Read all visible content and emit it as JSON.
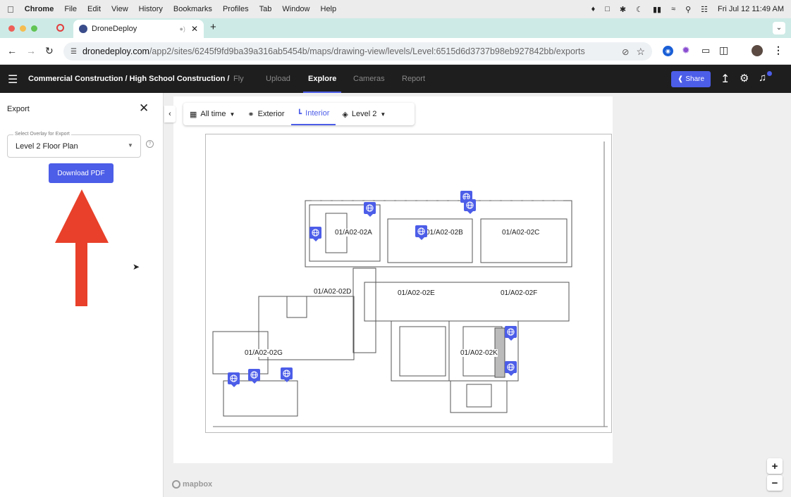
{
  "menubar": {
    "app": "Chrome",
    "items": [
      "File",
      "Edit",
      "View",
      "History",
      "Bookmarks",
      "Profiles",
      "Tab",
      "Window",
      "Help"
    ],
    "datetime": "Fri Jul 12  11:49 AM"
  },
  "browser": {
    "tab_title": "DroneDeploy",
    "url_domain": "dronedeploy.com",
    "url_path": "/app2/sites/6245f9fd9ba39a316ab5454b/maps/drawing-view/levels/Level:6515d6d3737b98eb927842bb/exports"
  },
  "header": {
    "breadcrumb": "Commercial Construction / High School Construction /",
    "tabs": [
      "Fly",
      "Upload",
      "Explore",
      "Cameras",
      "Report"
    ],
    "active_tab": "Explore",
    "share_label": "Share"
  },
  "export_panel": {
    "title": "Export",
    "select_label": "Select Overlay for Export",
    "select_value": "Level 2 Floor Plan",
    "download_label": "Download PDF"
  },
  "map_toolbar": {
    "time": "All time",
    "exterior": "Exterior",
    "interior": "Interior",
    "level": "Level 2"
  },
  "floorplan": {
    "rooms": [
      "01/A02-02A",
      "01/A02-02B",
      "01/A02-02C",
      "01/A02-02D",
      "01/A02-02E",
      "01/A02-02F",
      "01/A02-02G",
      "01/A02-02K"
    ]
  },
  "map_attribution": "mapbox",
  "colors": {
    "accent": "#4c5de8",
    "annotation_arrow": "#e8402a",
    "tab_strip": "#cdeae6"
  }
}
